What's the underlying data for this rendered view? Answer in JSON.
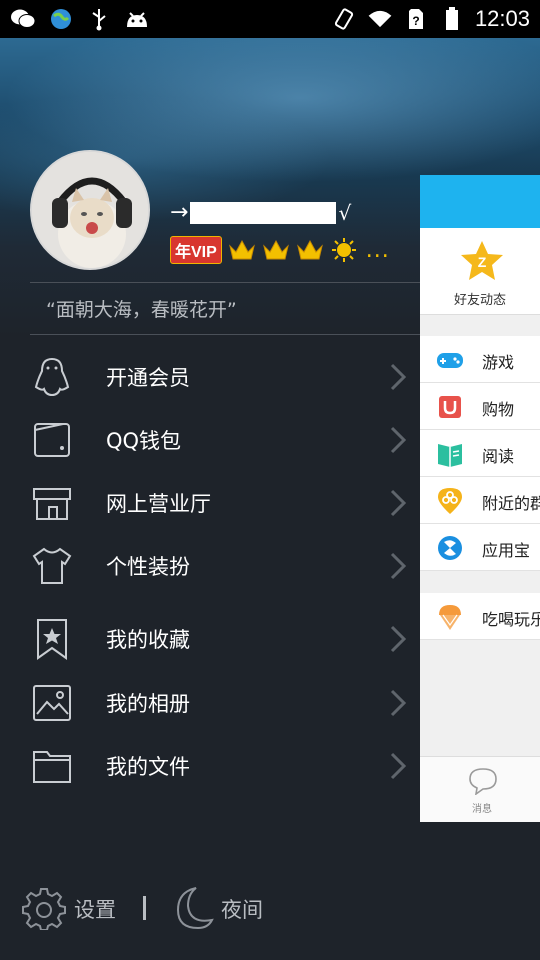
{
  "status_bar": {
    "time": "12:03",
    "left_icons": [
      "wechat-icon",
      "browser-globe-icon",
      "usb-icon",
      "android-icon"
    ],
    "right_icons": [
      "vibrate-icon",
      "wifi-icon",
      "sim-unknown-icon",
      "battery-icon"
    ]
  },
  "profile": {
    "nickname_prefix": "→",
    "nickname_suffix": "√",
    "vip_badge": "年VIP",
    "level_icons": [
      "crown-icon",
      "crown-icon",
      "crown-icon",
      "sun-icon"
    ],
    "level_more": "...",
    "signature": "“面朝大海，春暖花开”"
  },
  "menu": {
    "items": [
      {
        "label": "开通会员",
        "icon": "penguin-icon"
      },
      {
        "label": "QQ钱包",
        "icon": "wallet-icon"
      },
      {
        "label": "网上营业厅",
        "icon": "store-icon"
      },
      {
        "label": "个性装扮",
        "icon": "tshirt-icon"
      },
      {
        "label": "我的收藏",
        "icon": "bookmark-star-icon"
      },
      {
        "label": "我的相册",
        "icon": "photo-album-icon"
      },
      {
        "label": "我的文件",
        "icon": "folder-icon"
      }
    ]
  },
  "bottom_bar": {
    "settings_label": "设置",
    "night_label": "夜间"
  },
  "main_panel": {
    "feed_label": "好友动态",
    "items": [
      {
        "label": "游戏",
        "icon": "gamepad-icon",
        "color": "#1fa0e8"
      },
      {
        "label": "购物",
        "icon": "shopping-bag-icon",
        "color": "#e8524b"
      },
      {
        "label": "阅读",
        "icon": "book-icon",
        "color": "#2bbf9f"
      },
      {
        "label": "附近的群",
        "icon": "nearby-group-icon",
        "color": "#f5b31a"
      },
      {
        "label": "应用宝",
        "icon": "app-store-icon",
        "color": "#1a8fe0"
      },
      {
        "label": "吃喝玩乐",
        "icon": "ice-cream-icon",
        "color": "#f59a3b"
      }
    ],
    "tab_label": "消息"
  },
  "colors": {
    "accent_blue": "#1eb3ef",
    "drawer_bg": "#1e232a",
    "vip_red": "#d8362f",
    "crown_gold": "#f3c000"
  }
}
